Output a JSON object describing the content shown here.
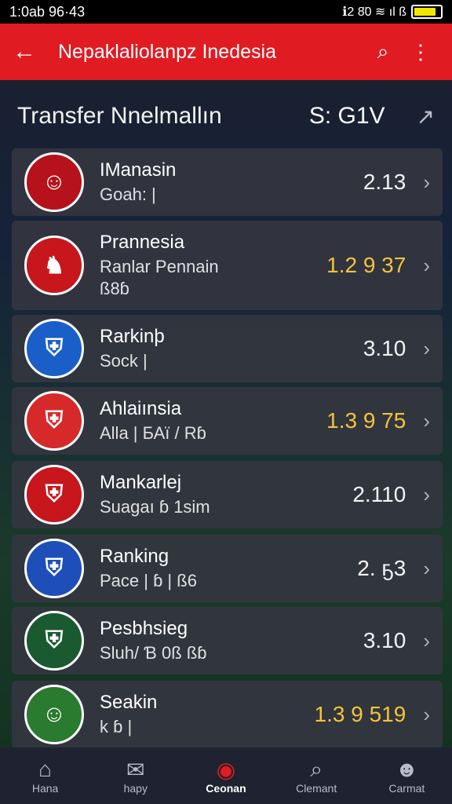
{
  "status": {
    "time": "1:0ab 96·43",
    "icons": "ℹ2 8̈0 ≋ ıl ß",
    "battery_level": 0.85
  },
  "appbar": {
    "title": "Nepaklaliolanpz Inedesia",
    "back_icon": "back-arrow-icon",
    "search_icon": "search-icon",
    "menu_icon": "more-vertical-icon"
  },
  "section": {
    "title": "Transfer Nnelmallın",
    "value": "S: G1V",
    "trend_icon": "trend-arrow-icon"
  },
  "rows": [
    {
      "name": "IManasin",
      "sub": "Goah: |",
      "sub2": "",
      "value": "2.13",
      "highlight": false,
      "crest_color": "#b5121b",
      "crest_glyph": "☺"
    },
    {
      "name": "Prannesia",
      "sub": "Ranlar Pennain",
      "sub2": "ß8ɓ",
      "value": "1.2  9 37",
      "highlight": true,
      "crest_color": "#c8161d",
      "crest_glyph": "♞"
    },
    {
      "name": "Rarkinþ",
      "sub": "Sock |",
      "sub2": "",
      "value": "3.10",
      "highlight": false,
      "crest_color": "#1a5fc8",
      "crest_glyph": "⛨"
    },
    {
      "name": "Ahlaiınsia",
      "sub": "Alla | БАї / Rɓ",
      "sub2": "",
      "value": "1.3  9 75",
      "highlight": true,
      "crest_color": "#d62a2a",
      "crest_glyph": "⛨"
    },
    {
      "name": "Mankarlej",
      "sub": "Suagaı ɓ 1sim",
      "sub2": "",
      "value": "2.110",
      "highlight": false,
      "crest_color": "#c8161d",
      "crest_glyph": "⛨"
    },
    {
      "name": "Ranking",
      "sub": "Pace | ɓ | ß6",
      "sub2": "",
      "value": "2. ҕ3",
      "highlight": false,
      "crest_color": "#1e4fb8",
      "crest_glyph": "⛨"
    },
    {
      "name": "Pesbhsieg",
      "sub": "Sluh/ Ɓ 0ß ßɓ",
      "sub2": "",
      "value": "3.10",
      "highlight": false,
      "crest_color": "#1a5a30",
      "crest_glyph": "⛨"
    },
    {
      "name": "Seakin",
      "sub": "k ɓ |",
      "sub2": "",
      "value": "1.3  9 519",
      "highlight": true,
      "crest_color": "#2a7a30",
      "crest_glyph": "☺"
    }
  ],
  "nav": [
    {
      "label": "Hana",
      "icon": "home-icon",
      "active": false
    },
    {
      "label": "hapy",
      "icon": "chat-icon",
      "active": false
    },
    {
      "label": "Ceonan",
      "icon": "ball-icon",
      "active": true
    },
    {
      "label": "Clemant",
      "icon": "search-icon",
      "active": false
    },
    {
      "label": "Carmat",
      "icon": "profile-icon",
      "active": false
    }
  ]
}
